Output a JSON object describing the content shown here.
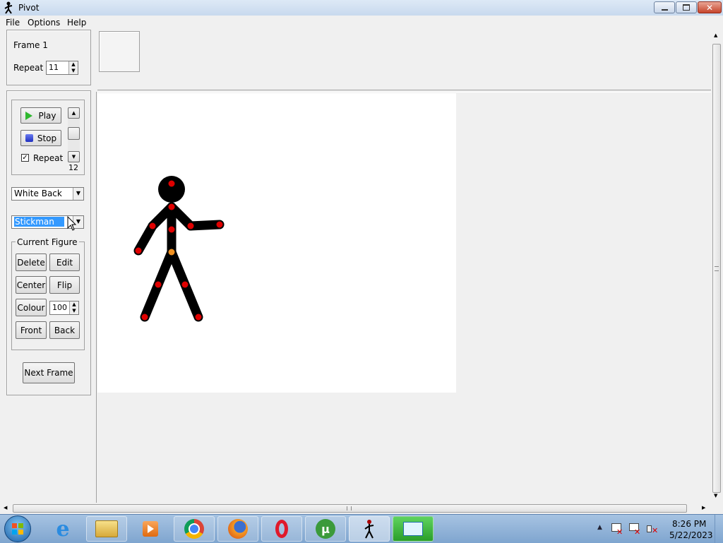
{
  "window": {
    "title": "Pivot"
  },
  "menu": {
    "items": [
      "File",
      "Options",
      "Help"
    ]
  },
  "frame_panel": {
    "frame_label": "Frame 1",
    "repeat_label": "Repeat :",
    "repeat_value": "11"
  },
  "playback": {
    "play_label": "Play",
    "stop_label": "Stop",
    "repeat_label": "Repeat",
    "repeat_checked": true,
    "speed_value": "12"
  },
  "background_select": {
    "value": "White Back"
  },
  "figure_select": {
    "value": "Stickman"
  },
  "current_figure": {
    "legend": "Current Figure",
    "delete_label": "Delete",
    "edit_label": "Edit",
    "center_label": "Center",
    "flip_label": "Flip",
    "colour_label": "Colour",
    "colour_value": "100",
    "front_label": "Front",
    "back_label": "Back"
  },
  "next_frame_label": "Next Frame",
  "colors": {
    "handle": "#e00000",
    "origin_handle": "#f09020",
    "figure": "#000000"
  },
  "taskbar": {
    "apps": [
      "start-orb-icon",
      "internet-explorer-icon",
      "file-explorer-icon",
      "media-player-icon",
      "chrome-icon",
      "firefox-icon",
      "opera-icon",
      "utorrent-icon",
      "pivot-icon",
      "screen-recorder-icon"
    ],
    "time": "8:26 PM",
    "date": "5/22/2023"
  }
}
